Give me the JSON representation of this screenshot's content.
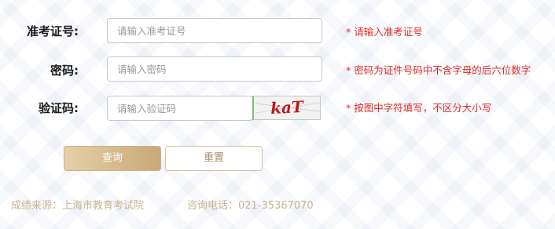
{
  "form": {
    "exam_id": {
      "label": "准考证号:",
      "placeholder": "请输入准考证号",
      "hint": "* 请输入准考证号"
    },
    "password": {
      "label": "密码:",
      "placeholder": "请输入密码",
      "hint": "* 密码为证件号码中不含字母的后六位数字"
    },
    "captcha": {
      "label": "验证码:",
      "placeholder": "请输入验证码",
      "image_text": "kaT",
      "hint": "* 按图中字符填写，不区分大小写"
    }
  },
  "buttons": {
    "query": "查询",
    "reset": "重置"
  },
  "footer": {
    "source": "成绩来源：上海市教育考试院",
    "phone": "咨询电话：021-35367070"
  },
  "colors": {
    "hint": "#e02a2a",
    "gold": "#c9a87a",
    "footer": "#c8b48f",
    "captcha_text": "#c01818"
  }
}
